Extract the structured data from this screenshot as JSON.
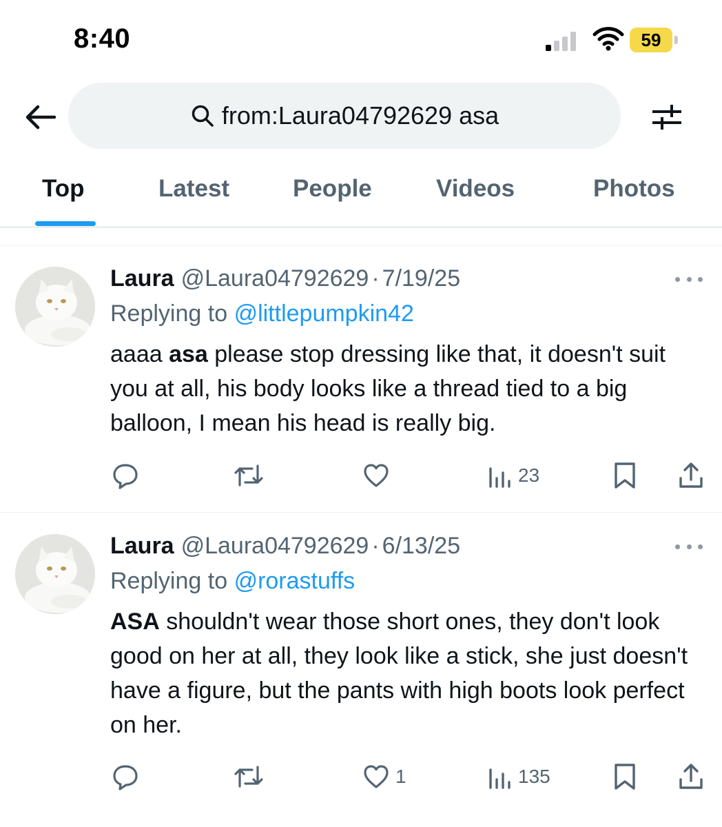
{
  "status_bar": {
    "time": "8:40",
    "battery": "59"
  },
  "search": {
    "query": "from:Laura04792629 asa"
  },
  "tabs": [
    {
      "label": "Top",
      "active": true
    },
    {
      "label": "Latest"
    },
    {
      "label": "People"
    },
    {
      "label": "Videos"
    },
    {
      "label": "Photos"
    }
  ],
  "tweets": [
    {
      "name": "Laura",
      "handle": "@Laura04792629",
      "dot": "·",
      "date": "7/19/25",
      "replying_prefix": "Replying to",
      "replying_to": "@littlepumpkin42",
      "text_pre": "aaaa ",
      "text_bold": "asa",
      "text_post": " please stop dressing like that, it doesn't suit you at all, his body looks like a thread tied to a big balloon, I mean his head is really big.",
      "likes": "",
      "views": "23"
    },
    {
      "name": "Laura",
      "handle": "@Laura04792629",
      "dot": "·",
      "date": "6/13/25",
      "replying_prefix": "Replying to",
      "replying_to": "@rorastuffs",
      "text_pre": "",
      "text_bold": "ASA",
      "text_post": " shouldn't wear those short ones, they don't look good on her at all, they look like a stick, she just doesn't have a figure, but the pants with high boots look perfect on her.",
      "likes": "1",
      "views": "135"
    }
  ],
  "colors": {
    "accent": "#1d9bf0",
    "text": "#0f1419",
    "muted": "#536471",
    "search_bg": "#eff3f4",
    "battery": "#f5d94a"
  },
  "icons": [
    "back-arrow-icon",
    "search-icon",
    "filter-sliders-icon",
    "more-icon",
    "reply-icon",
    "retweet-icon",
    "like-icon",
    "views-icon",
    "bookmark-icon",
    "share-icon",
    "signal-icon",
    "wifi-icon",
    "battery-icon"
  ]
}
